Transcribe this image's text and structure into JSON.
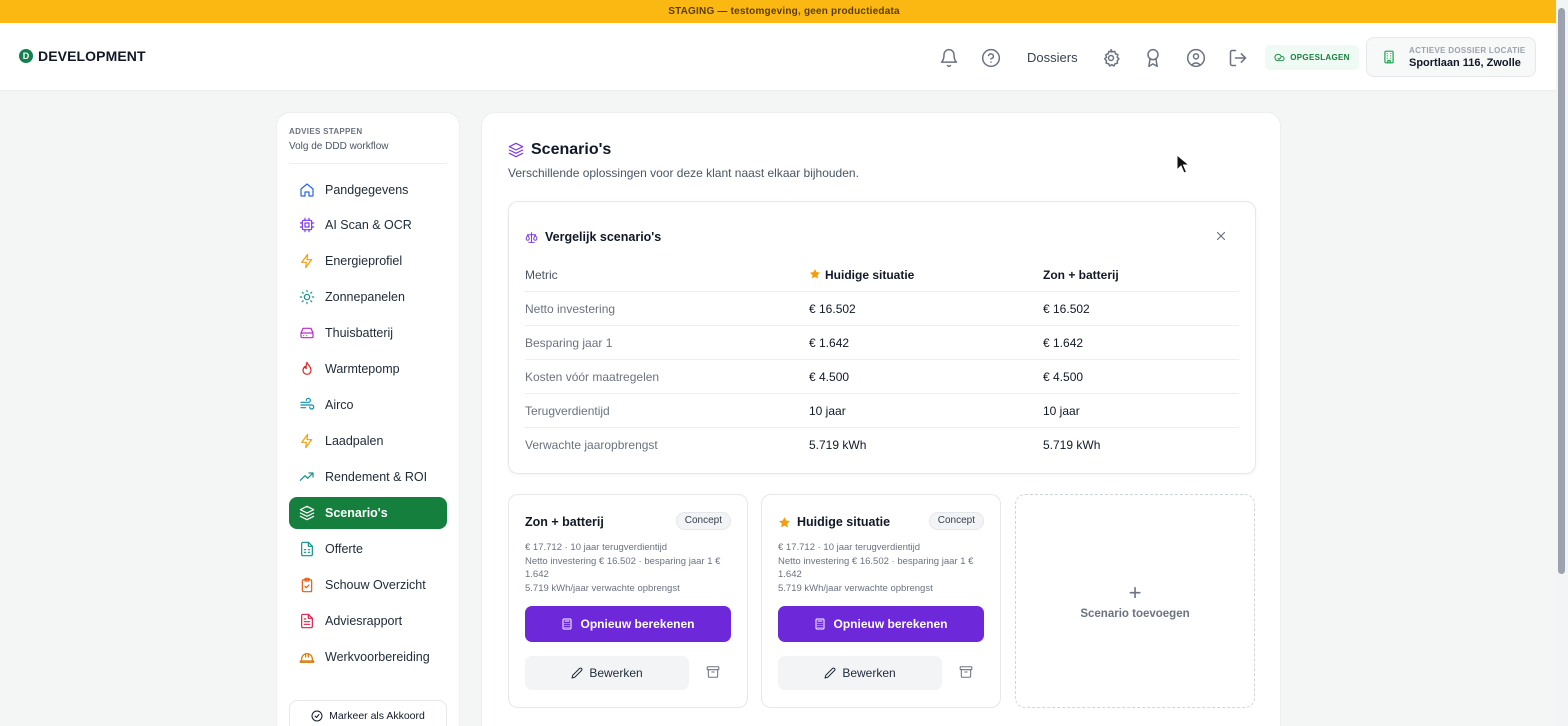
{
  "banner": {
    "text": "STAGING — testomgeving, geen productiedata"
  },
  "brand": {
    "mark": "D",
    "name": "DEVELOPMENT",
    "color": "#12814f"
  },
  "topbar": {
    "icons": [
      "bell-icon",
      "help-icon",
      "settings-icon",
      "award-icon",
      "user-icon",
      "logout-icon"
    ],
    "dossiers_label": "Dossiers",
    "saved_label": "OPGESLAGEN",
    "location": {
      "label": "ACTIEVE DOSSIER LOCATIE",
      "value": "Sportlaan 116, Zwolle"
    }
  },
  "sidebar": {
    "title": "ADVIES STAPPEN",
    "subtitle": "Volg de DDD workflow",
    "items": [
      {
        "label": "Pandgegevens",
        "icon": "home-icon",
        "color": "#2563eb"
      },
      {
        "label": "AI Scan & OCR",
        "icon": "cpu-icon",
        "color": "#7c3aed"
      },
      {
        "label": "Energieprofiel",
        "icon": "bolt-icon",
        "color": "#f59e0b"
      },
      {
        "label": "Zonnepanelen",
        "icon": "sun-icon",
        "color": "#0d9488"
      },
      {
        "label": "Thuisbatterij",
        "icon": "battery-icon",
        "color": "#c026d3"
      },
      {
        "label": "Warmtepomp",
        "icon": "flame-icon",
        "color": "#dc2626"
      },
      {
        "label": "Airco",
        "icon": "wind-icon",
        "color": "#0891b2"
      },
      {
        "label": "Laadpalen",
        "icon": "bolt-icon",
        "color": "#f59e0b"
      },
      {
        "label": "Rendement & ROI",
        "icon": "trend-up-icon",
        "color": "#0d9488"
      },
      {
        "label": "Scenario's",
        "icon": "layers-icon",
        "color": "#ffffff",
        "active": true
      },
      {
        "label": "Offerte",
        "icon": "file-sheet-icon",
        "color": "#0d9488"
      },
      {
        "label": "Schouw Overzicht",
        "icon": "clipboard-check-icon",
        "color": "#ea580c"
      },
      {
        "label": "Adviesrapport",
        "icon": "file-text-icon",
        "color": "#e11d48"
      },
      {
        "label": "Werkvoorbereiding",
        "icon": "helmet-icon",
        "color": "#d97706"
      }
    ],
    "approve_label": "Markeer als Akkoord"
  },
  "main": {
    "title": "Scenario's",
    "subtitle": "Verschillende oplossingen voor deze klant naast elkaar bijhouden."
  },
  "compare": {
    "title": "Vergelijk scenario's",
    "columns": [
      "Metric",
      "Huidige situatie",
      "Zon + batterij"
    ],
    "rows": [
      [
        "Netto investering",
        "€ 16.502",
        "€ 16.502"
      ],
      [
        "Besparing jaar 1",
        "€ 1.642",
        "€ 1.642"
      ],
      [
        "Kosten vóór maatregelen",
        "€ 4.500",
        "€ 4.500"
      ],
      [
        "Terugverdientijd",
        "10 jaar",
        "10 jaar"
      ],
      [
        "Verwachte jaaropbrengst",
        "5.719 kWh",
        "5.719 kWh"
      ]
    ]
  },
  "scenarios": [
    {
      "name": "Zon + batterij",
      "starred": false,
      "badge": "Concept",
      "line1": "€ 17.712 · 10 jaar terugverdientijd",
      "line2": "Netto investering € 16.502 · besparing jaar 1 € 1.642",
      "line3": "5.719 kWh/jaar verwachte opbrengst",
      "recalc_label": "Opnieuw berekenen",
      "edit_label": "Bewerken"
    },
    {
      "name": "Huidige situatie",
      "starred": true,
      "badge": "Concept",
      "line1": "€ 17.712 · 10 jaar terugverdientijd",
      "line2": "Netto investering € 16.502 · besparing jaar 1 € 1.642",
      "line3": "5.719 kWh/jaar verwachte opbrengst",
      "recalc_label": "Opnieuw berekenen",
      "edit_label": "Bewerken"
    }
  ],
  "add_scenario": {
    "plus": "+",
    "label": "Scenario toevoegen"
  },
  "colors": {
    "accent_green": "#15803d",
    "accent_purple": "#6d28d9",
    "banner": "#fbb813",
    "star": "#f59e0b"
  }
}
